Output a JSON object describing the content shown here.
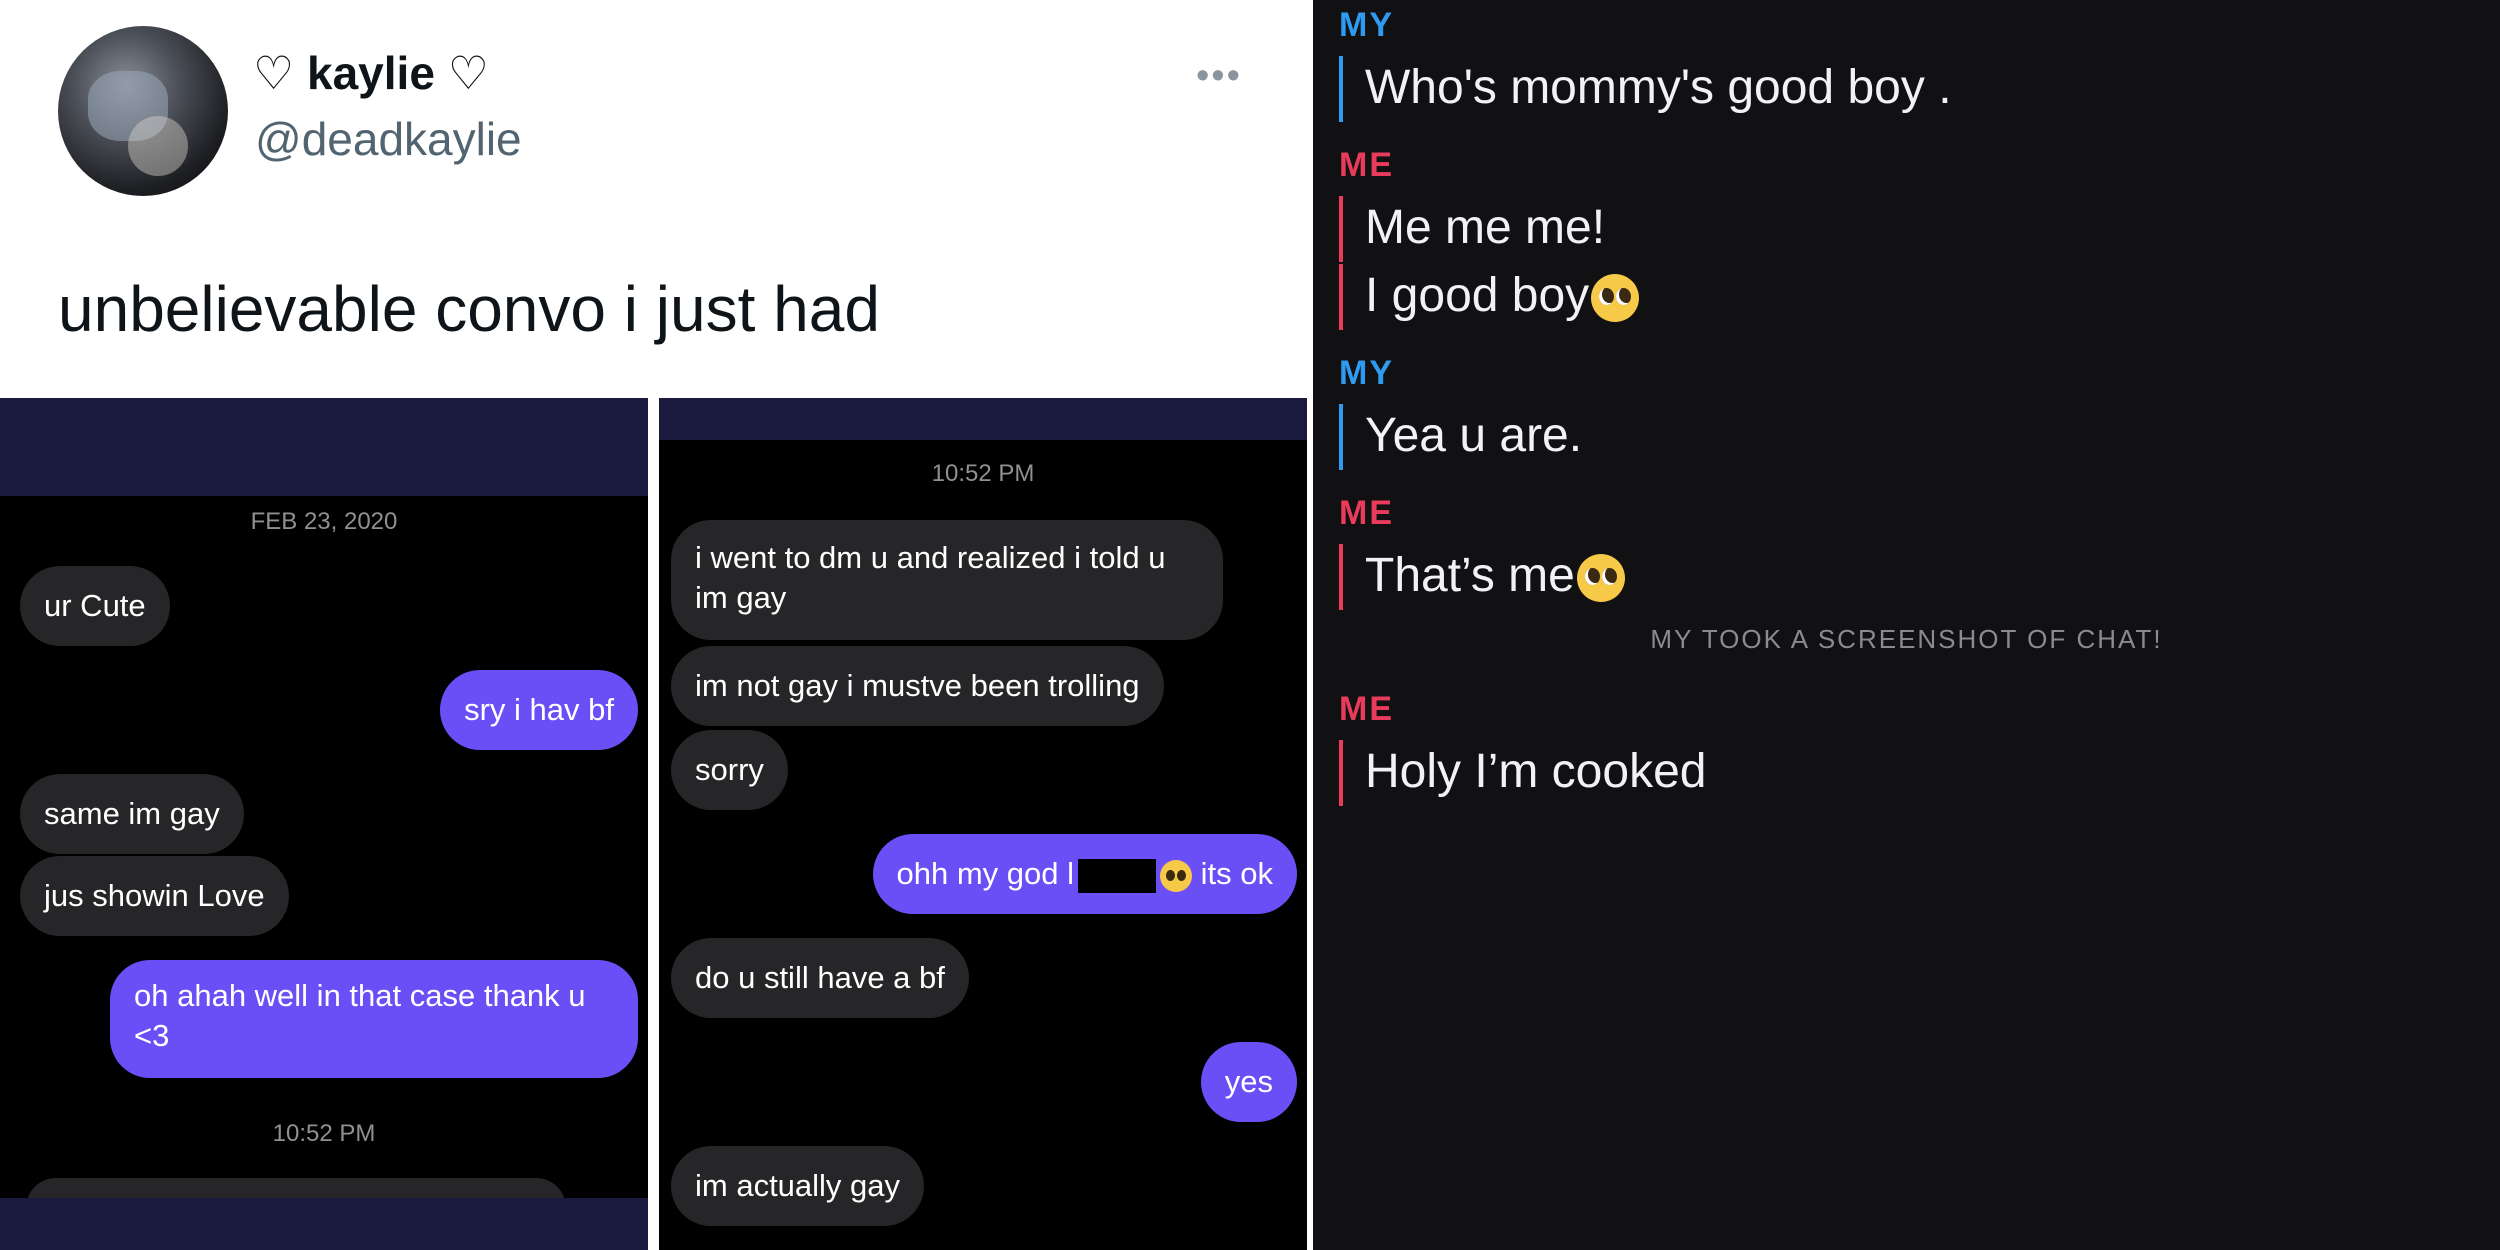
{
  "tweet": {
    "display_name": "♡ kaylie ♡",
    "handle": "@deadkaylie",
    "more_icon": "•••",
    "text": "unbelievable convo i just had"
  },
  "screenshot_left": {
    "date": "FEB 23, 2020",
    "messages": [
      {
        "side": "in",
        "text": "ur Cute"
      },
      {
        "side": "out",
        "text": "sry i hav bf"
      },
      {
        "side": "in",
        "text": "same im gay"
      },
      {
        "side": "in",
        "text": "jus showin Love"
      },
      {
        "side": "out",
        "text": "oh ahah well in that case thank u <3"
      }
    ],
    "time": "10:52 PM"
  },
  "screenshot_right": {
    "time": "10:52 PM",
    "messages": [
      {
        "side": "in",
        "text": "i went to dm u and realized i told u im gay"
      },
      {
        "side": "in",
        "text": "im not gay i mustve been trolling"
      },
      {
        "side": "in",
        "text": "sorry"
      },
      {
        "side": "out",
        "text_before": "ohh my god l",
        "text_after": "its ok"
      },
      {
        "side": "in",
        "text": "do u still have a bf"
      },
      {
        "side": "out",
        "text": "yes"
      },
      {
        "side": "in",
        "text": "im actually gay"
      }
    ]
  },
  "chat": {
    "colors": {
      "my": "#2f9bf0",
      "me": "#ea3c5a",
      "background": "#111114"
    },
    "blocks": [
      {
        "sender": "MY",
        "lines": [
          "Who's mommy's good boy ."
        ]
      },
      {
        "sender": "ME",
        "lines": [
          "Me me me!",
          "I good boy"
        ]
      },
      {
        "sender": "MY",
        "lines": [
          "Yea u are."
        ]
      },
      {
        "sender": "ME",
        "lines": [
          "That’s me"
        ]
      },
      {
        "sender": "ME",
        "lines": [
          "Holy I’m cooked"
        ]
      }
    ],
    "screenshot_notice": "MY TOOK A SCREENSHOT OF CHAT!"
  }
}
